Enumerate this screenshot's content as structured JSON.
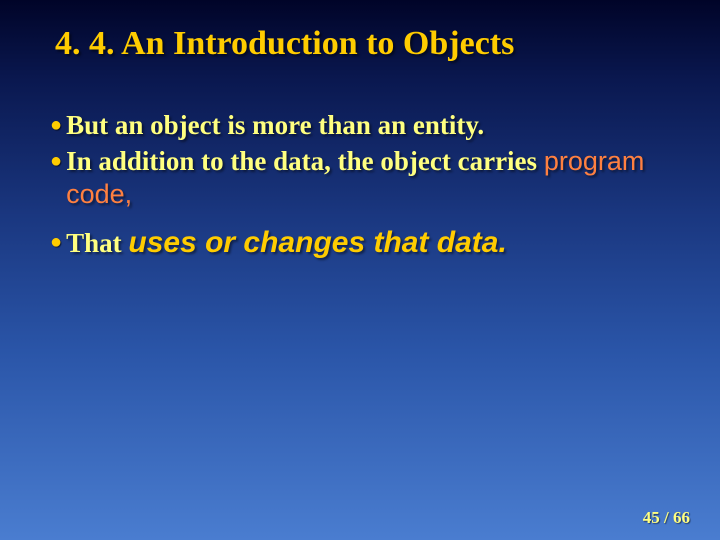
{
  "title": "4. 4.  An Introduction to Objects",
  "bullets": {
    "b1": "But an object is more than an entity.",
    "b2_lead": "In addition to the data, the object carries ",
    "b2_emph": "program code,",
    "b3_lead": "That ",
    "b3_emph": "uses or changes that data."
  },
  "footer": {
    "current": "45",
    "sep": " / ",
    "total": "66"
  }
}
